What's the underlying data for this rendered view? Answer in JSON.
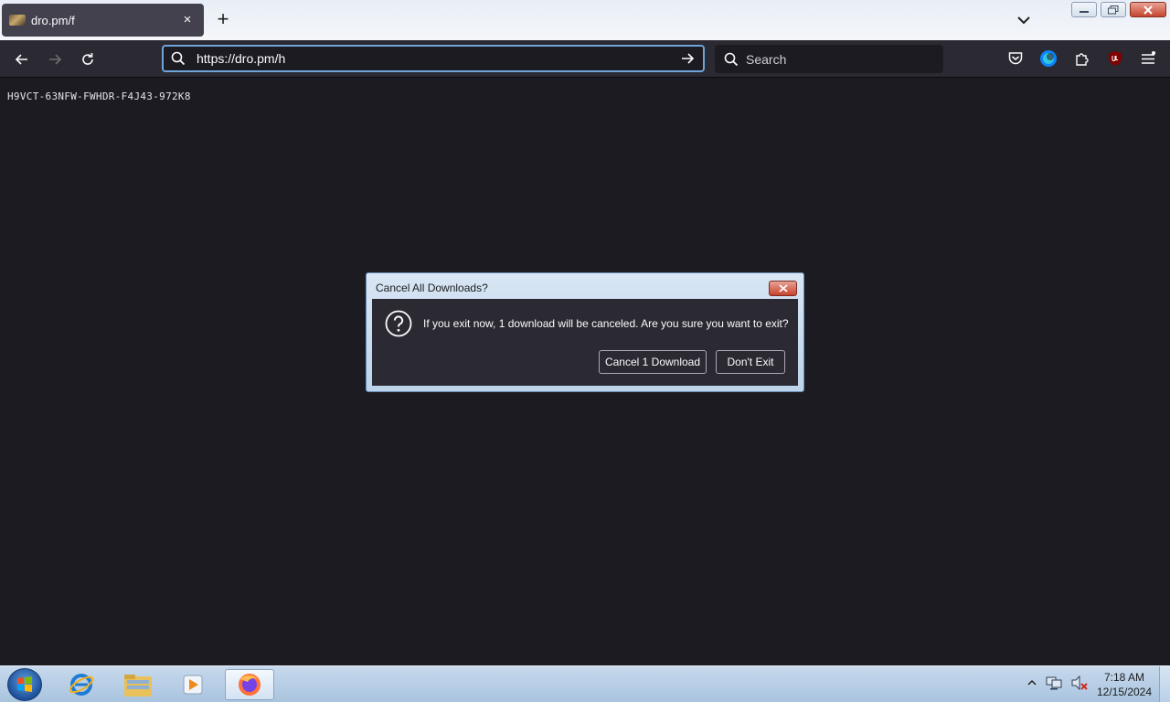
{
  "browser": {
    "tab": {
      "title": "dro.pm/f",
      "close_glyph": "×"
    },
    "new_tab_glyph": "+",
    "url": "https://dro.pm/h",
    "search_placeholder": "Search"
  },
  "page": {
    "serial": "H9VCT-63NFW-FWHDR-F4J43-972K8"
  },
  "dialog": {
    "title": "Cancel All Downloads?",
    "message": "If you exit now, 1 download will be canceled. Are you sure you want to exit?",
    "cancel_button": "Cancel 1 Download",
    "dont_exit_button": "Don't Exit",
    "icon": "question-icon"
  },
  "taskbar": {
    "time": "7:18 AM",
    "date": "12/15/2024",
    "apps": [
      "internet-explorer",
      "file-explorer",
      "media-player",
      "firefox"
    ]
  },
  "colors": {
    "page_bg": "#1c1b22",
    "toolbar_bg": "#2b2a33",
    "urlbar_focus": "#6fa4d8",
    "taskbar": "#b4cce4"
  }
}
